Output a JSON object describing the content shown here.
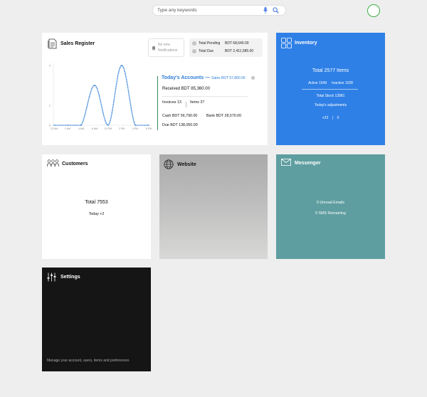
{
  "search": {
    "placeholder": "Type any keywords"
  },
  "icons": [
    "search-icon",
    "mic-icon",
    "bell-icon",
    "doc-icon",
    "grid-icon",
    "people-icon",
    "globe-icon",
    "mail-icon",
    "sliders-icon"
  ],
  "colors": {
    "inventory_bg": "#2f80e6",
    "messenger_bg": "#5f9ea0",
    "settings_bg": "#151515",
    "status_ring": "#3cb043",
    "accent_blue": "#2f7fd8"
  },
  "sales": {
    "title": "Sales Register",
    "notifications": "No new Notifications",
    "total_pending_label": "Total Pending",
    "total_pending_value": "BDT 68,640.00",
    "total_due_label": "Total Due",
    "total_due_value": "BDT 2,411,585.00",
    "accounts_title": "Today's Accounts",
    "accounts_dash": "—",
    "accounts_sales": "Sales BDT 57,860.00",
    "received": "Received BDT 85,360.00",
    "invoices": "Invoices 13",
    "items": "Items 37",
    "cash": "Cash BDT 56,790.00",
    "bank": "Bank BDT 28,570.00",
    "due": "Due BDT 138,050.00"
  },
  "chart_data": {
    "type": "line",
    "x": [
      "12 AM",
      "2 AM",
      "4 AM",
      "6 AM",
      "10 PM",
      "2 PM",
      "4 PM",
      "6 PM"
    ],
    "values": [
      0,
      0,
      0,
      2,
      0,
      3,
      0,
      0
    ],
    "yticks": [
      "0",
      "1",
      "3"
    ],
    "ylim": [
      0,
      3
    ],
    "color": "#2f7fd8",
    "grid": false
  },
  "inventory": {
    "title": "Inventory",
    "total": "Total 2577 Items",
    "active": "Active 1549",
    "inactive": "Inactive 1028",
    "stock": "Total Stock 13981",
    "adjustments": "Today's adjustments",
    "adj_plus": "+23",
    "adj_sep": "|",
    "adj_value": "0"
  },
  "customers": {
    "title": "Customers",
    "total": "Total 7553",
    "today": "Today +2"
  },
  "website": {
    "title": "Website"
  },
  "messenger": {
    "title": "Messenger",
    "unread": "0 Unread Emails",
    "sms": "0 SMS Remaining"
  },
  "settings": {
    "title": "Settings",
    "desc": "Manage your account, users, items and preferences"
  }
}
